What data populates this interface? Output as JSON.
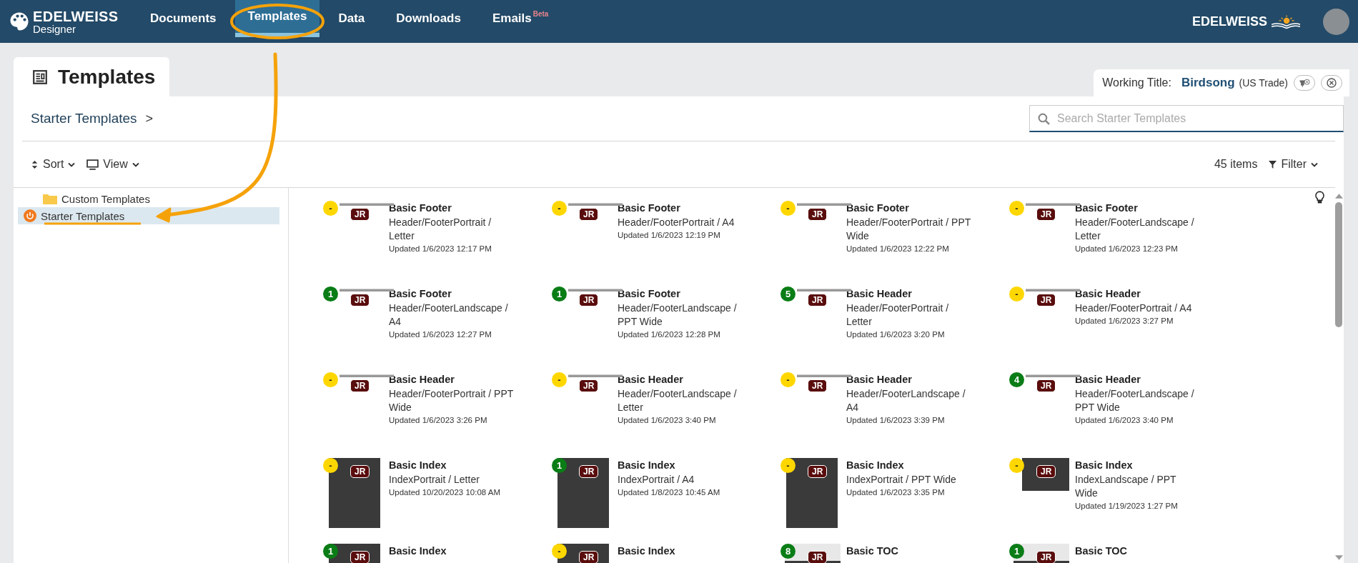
{
  "nav": {
    "logo_title": "EDELWEISS",
    "logo_subtitle": "Designer",
    "brand": "EDELWEISS",
    "items": [
      {
        "label": "Documents",
        "selected": false
      },
      {
        "label": "Templates",
        "selected": true
      },
      {
        "label": "Data",
        "selected": false
      },
      {
        "label": "Downloads",
        "selected": false
      },
      {
        "label": "Emails",
        "selected": false,
        "badge": "Beta"
      }
    ]
  },
  "page_tab": "Templates",
  "working_title": {
    "label": "Working Title:",
    "title": "Birdsong",
    "edition": "(US Trade)"
  },
  "breadcrumb": {
    "label": "Starter Templates",
    "separator": ">"
  },
  "search": {
    "placeholder": "Search Starter Templates"
  },
  "toolbar": {
    "sort": "Sort",
    "view": "View",
    "count": "45 items",
    "filter": "Filter"
  },
  "sidebar": {
    "items": [
      {
        "label": "Custom Templates",
        "kind": "folder",
        "selected": false
      },
      {
        "label": "Starter Templates",
        "kind": "starter",
        "selected": true
      }
    ]
  },
  "templates": [
    {
      "title": "Basic Footer",
      "subtitle": "Header/FooterPortrait / Letter",
      "updated": "Updated 1/6/2023 12:17 PM",
      "badge": "-",
      "color": "#ffd700",
      "kind": "strip",
      "initials": "JR"
    },
    {
      "title": "Basic Footer",
      "subtitle": "Header/FooterPortrait / A4",
      "updated": "Updated 1/6/2023 12:19 PM",
      "badge": "-",
      "color": "#ffd700",
      "kind": "strip",
      "initials": "JR"
    },
    {
      "title": "Basic Footer",
      "subtitle": "Header/FooterPortrait / PPT Wide",
      "updated": "Updated 1/6/2023 12:22 PM",
      "badge": "-",
      "color": "#ffd700",
      "kind": "strip",
      "initials": "JR"
    },
    {
      "title": "Basic Footer",
      "subtitle": "Header/FooterLandscape / Letter",
      "updated": "Updated 1/6/2023 12:23 PM",
      "badge": "-",
      "color": "#ffd700",
      "kind": "strip",
      "initials": "JR"
    },
    {
      "title": "Basic Footer",
      "subtitle": "Header/FooterLandscape / A4",
      "updated": "Updated 1/6/2023 12:27 PM",
      "badge": "1",
      "color": "#0a7d16",
      "kind": "strip",
      "initials": "JR"
    },
    {
      "title": "Basic Footer",
      "subtitle": "Header/FooterLandscape / PPT Wide",
      "updated": "Updated 1/6/2023 12:28 PM",
      "badge": "1",
      "color": "#0a7d16",
      "kind": "strip",
      "initials": "JR"
    },
    {
      "title": "Basic Header",
      "subtitle": "Header/FooterPortrait / Letter",
      "updated": "Updated 1/6/2023 3:20 PM",
      "badge": "5",
      "color": "#0a7d16",
      "kind": "strip",
      "initials": "JR"
    },
    {
      "title": "Basic Header",
      "subtitle": "Header/FooterPortrait / A4",
      "updated": "Updated 1/6/2023 3:27 PM",
      "badge": "-",
      "color": "#ffd700",
      "kind": "strip",
      "initials": "JR"
    },
    {
      "title": "Basic Header",
      "subtitle": "Header/FooterPortrait / PPT Wide",
      "updated": "Updated 1/6/2023 3:26 PM",
      "badge": "-",
      "color": "#ffd700",
      "kind": "strip",
      "initials": "JR"
    },
    {
      "title": "Basic Header",
      "subtitle": "Header/FooterLandscape / Letter",
      "updated": "Updated 1/6/2023 3:40 PM",
      "badge": "-",
      "color": "#ffd700",
      "kind": "strip",
      "initials": "JR"
    },
    {
      "title": "Basic Header",
      "subtitle": "Header/FooterLandscape / A4",
      "updated": "Updated 1/6/2023 3:39 PM",
      "badge": "-",
      "color": "#ffd700",
      "kind": "strip",
      "initials": "JR"
    },
    {
      "title": "Basic Header",
      "subtitle": "Header/FooterLandscape / PPT Wide",
      "updated": "Updated 1/6/2023 3:40 PM",
      "badge": "4",
      "color": "#0a7d16",
      "kind": "strip",
      "initials": "JR"
    },
    {
      "title": "Basic Index",
      "subtitle": "IndexPortrait / Letter",
      "updated": "Updated 10/20/2023 10:08 AM",
      "badge": "-",
      "color": "#ffd700",
      "kind": "tall",
      "initials": "JR"
    },
    {
      "title": "Basic Index",
      "subtitle": "IndexPortrait / A4",
      "updated": "Updated 1/8/2023 10:45 AM",
      "badge": "1",
      "color": "#0a7d16",
      "kind": "tall",
      "initials": "JR"
    },
    {
      "title": "Basic Index",
      "subtitle": "IndexPortrait / PPT Wide",
      "updated": "Updated 1/6/2023 3:35 PM",
      "badge": "-",
      "color": "#ffd700",
      "kind": "tall",
      "initials": "JR"
    },
    {
      "title": "Basic Index",
      "subtitle": "IndexLandscape / PPT Wide",
      "updated": "Updated 1/19/2023 1:27 PM",
      "badge": "-",
      "color": "#ffd700",
      "kind": "wide",
      "initials": "JR"
    },
    {
      "title": "Basic Index",
      "badge": "1",
      "color": "#0a7d16",
      "kind": "tall",
      "initials": "JR"
    },
    {
      "title": "Basic Index",
      "badge": "-",
      "color": "#ffd700",
      "kind": "tall",
      "initials": "JR"
    },
    {
      "title": "Basic TOC",
      "badge": "8",
      "color": "#0a7d16",
      "kind": "page",
      "initials": "JR"
    },
    {
      "title": "Basic TOC",
      "badge": "1",
      "color": "#0a7d16",
      "kind": "page",
      "initials": "JR"
    }
  ]
}
